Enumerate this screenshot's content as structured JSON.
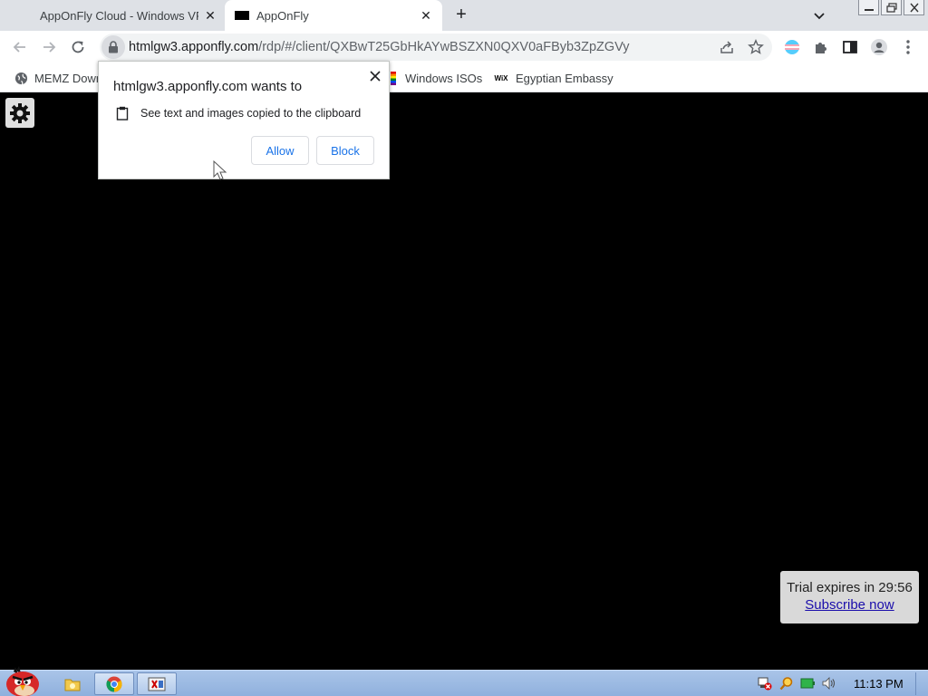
{
  "browser": {
    "tabs": [
      {
        "title": "AppOnFly Cloud - Windows VPS"
      },
      {
        "title": "AppOnFly"
      }
    ],
    "new_tab_symbol": "+",
    "url_host": "htmlgw3.apponfly.com",
    "url_path": "/rdp/#/client/QXBwT25GbHkAYwBSZXN0QXV0aFByb3ZpZGVy"
  },
  "bookmarks": [
    {
      "label": "MEMZ Down",
      "icon": "globe-icon"
    },
    {
      "label": "Windows ISOs",
      "icon": "flag-icon"
    },
    {
      "label": "Egyptian Embassy",
      "icon": "wix-icon",
      "icon_text": "WiX"
    }
  ],
  "popup": {
    "title": "htmlgw3.apponfly.com wants to",
    "permission": "See text and images copied to the clipboard",
    "allow_label": "Allow",
    "block_label": "Block"
  },
  "trial": {
    "text": "Trial expires in 29:56",
    "link": "Subscribe now"
  },
  "taskbar": {
    "clock": "11:13 PM"
  },
  "colors": {
    "accent": "#1a73e8",
    "tabstrip": "#dee1e6",
    "taskbar": "#9cbbe3"
  }
}
